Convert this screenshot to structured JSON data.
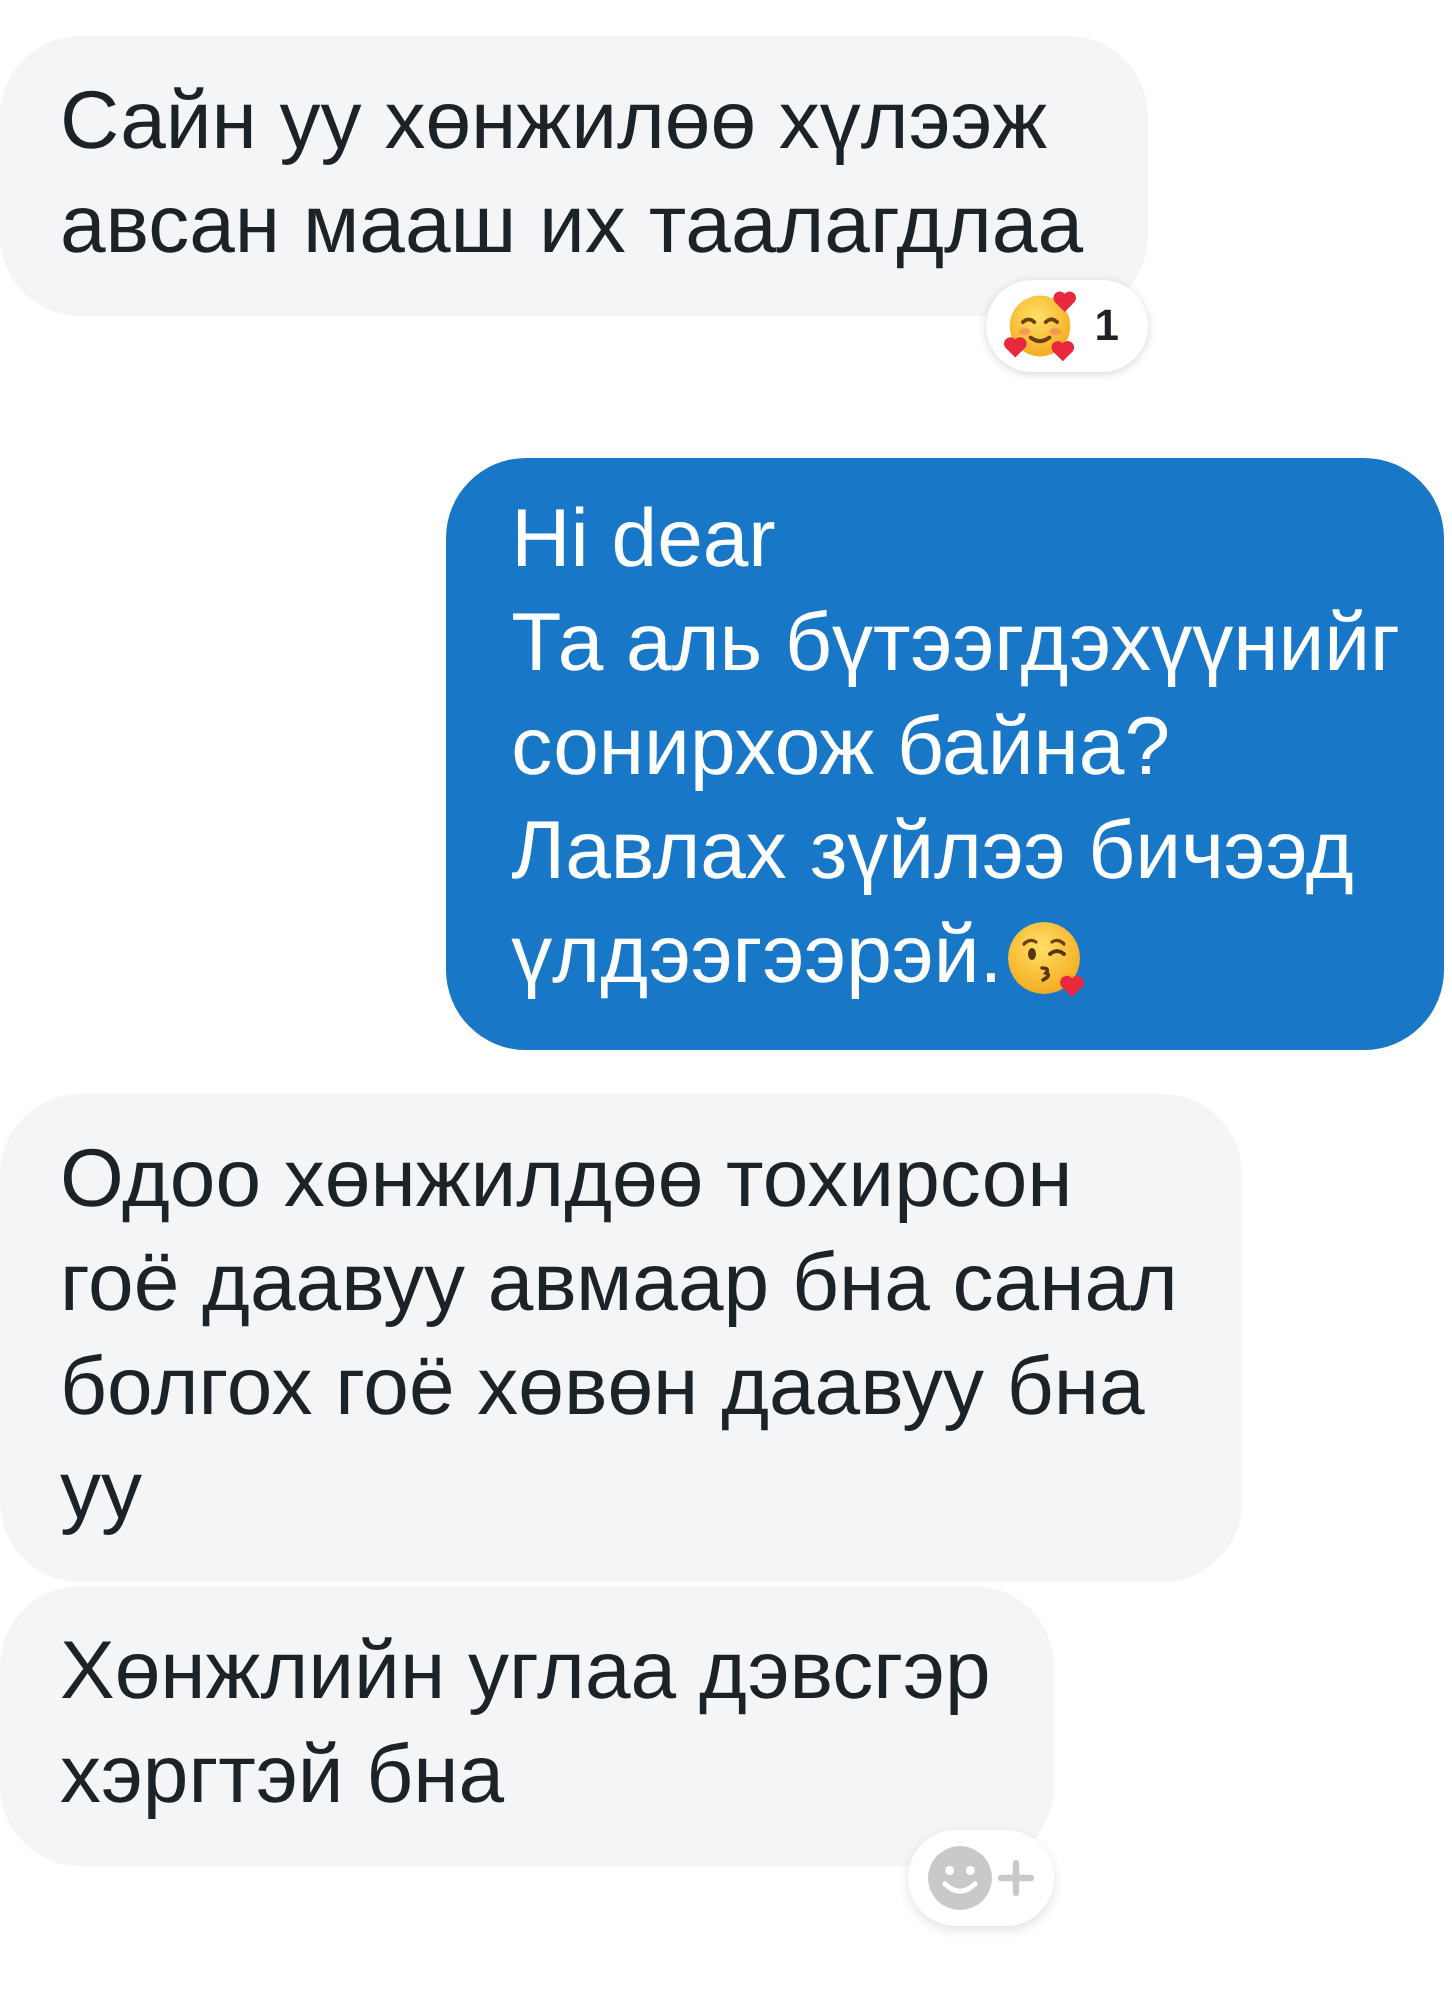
{
  "messages": [
    {
      "kind": "incoming",
      "text": "Сайн уу хөнжилөө хүлээж\nавсан мааш их таалагдлаа",
      "trailing_emoji": false,
      "reaction": {
        "count": "1"
      }
    },
    {
      "kind": "outgoing",
      "text": "Hi dear\nТа аль бүтээгдэхүүнийг\nсонирхож байна?\nЛавлах зүйлээ бичээд\nүлдээгээрэй.",
      "trailing_emoji": true
    },
    {
      "kind": "incoming",
      "text": "Одоо хөнжилдөө тохирсон\nгоё даавуу авмаар бна санал\nболгох гоё хөвөн даавуу бна\nуу",
      "trailing_emoji": false
    },
    {
      "kind": "incoming",
      "text": "Хөнжлийн углаа дэвсгэр\nхэргтэй бна",
      "trailing_emoji": false
    }
  ]
}
